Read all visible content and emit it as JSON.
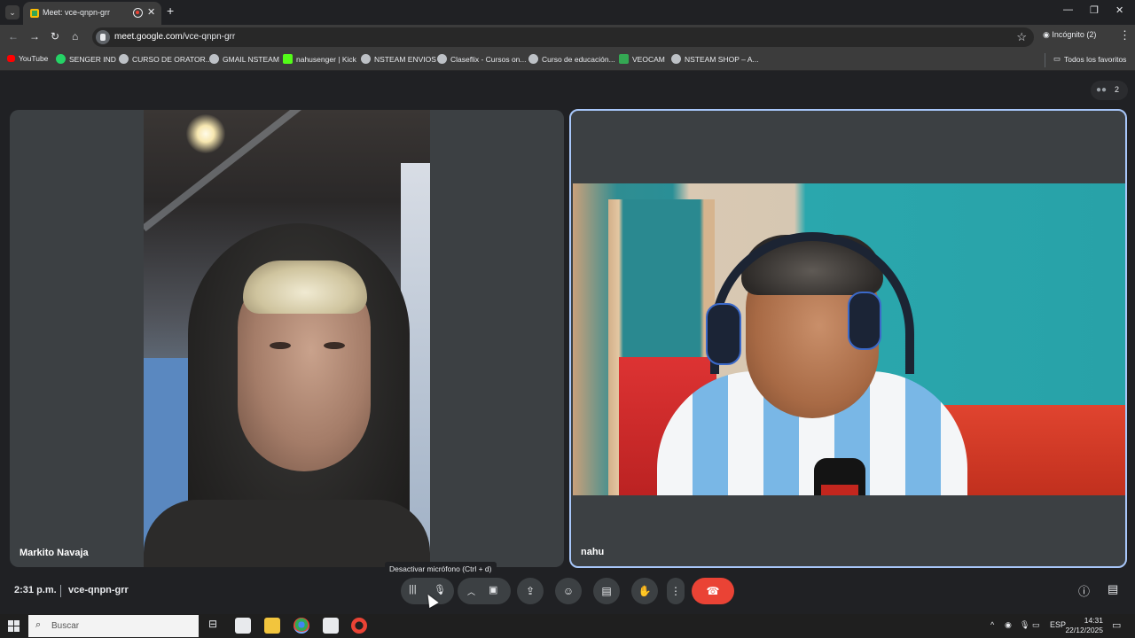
{
  "browser": {
    "tab_title": "Meet: vce-qnpn-grr",
    "url_host": "meet.google.com",
    "url_path": "/vce-qnpn-grr",
    "incognito_label": "Incógnito (2)",
    "bookmarks": [
      {
        "label": "YouTube",
        "icon": "youtube-icon"
      },
      {
        "label": "SENGER IND",
        "icon": "whatsapp-icon"
      },
      {
        "label": "CURSO DE ORATOR...",
        "icon": "globe-icon"
      },
      {
        "label": "GMAIL NSTEAM",
        "icon": "globe-icon"
      },
      {
        "label": "nahusenger | Kick",
        "icon": "kick-icon"
      },
      {
        "label": "NSTEAM ENVIOS",
        "icon": "globe-icon"
      },
      {
        "label": "Claseflix - Cursos on...",
        "icon": "globe-icon"
      },
      {
        "label": "Curso de educación...",
        "icon": "globe-icon"
      },
      {
        "label": "VEOCAM",
        "icon": "veocam-icon"
      },
      {
        "label": "NSTEAM SHOP – A...",
        "icon": "globe-icon"
      }
    ],
    "all_bookmarks_label": "Todos los favoritos"
  },
  "meet": {
    "participant_count": "2",
    "participants": [
      {
        "name": "Markito Navaja"
      },
      {
        "name": "nahu"
      }
    ],
    "time": "2:31 p.m.",
    "meeting_code": "vce-qnpn-grr",
    "mic_tooltip": "Desactivar micrófono (Ctrl + d)"
  },
  "taskbar": {
    "search_placeholder": "Buscar",
    "language": "ESP",
    "time": "14:31",
    "date": "22/12/2025"
  },
  "colors": {
    "hangup": "#ea4335",
    "active_tile_border": "#a8c7fa",
    "background": "#202124"
  }
}
